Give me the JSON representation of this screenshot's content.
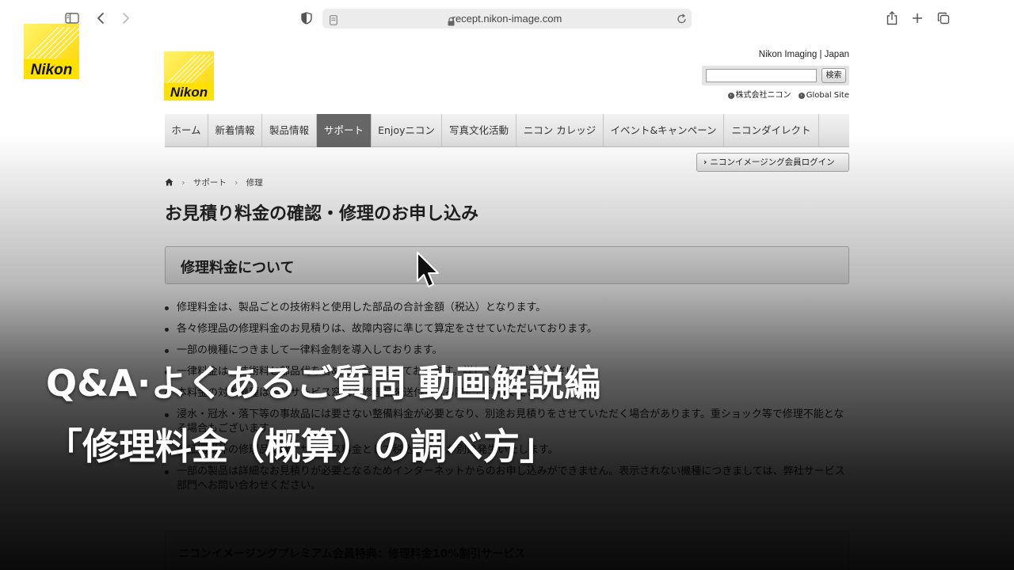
{
  "browser": {
    "url": "recept.nikon-image.com",
    "icons": [
      "sidebar-icon",
      "back-icon",
      "forward-icon",
      "shield-icon",
      "page-icon",
      "lock-icon",
      "reload-icon",
      "share-icon",
      "new-tab-icon",
      "tabs-icon"
    ]
  },
  "brand": {
    "logo_text": "Nikon",
    "accent": "#ffe100"
  },
  "header": {
    "site_label": "Nikon Imaging | Japan",
    "search_button": "検索",
    "search_value": "",
    "corp_link": "株式会社ニコン",
    "global_link": "Global Site"
  },
  "nav": {
    "items": [
      {
        "label": "ホーム",
        "active": false
      },
      {
        "label": "新着情報",
        "active": false
      },
      {
        "label": "製品情報",
        "active": false
      },
      {
        "label": "サポート",
        "active": true
      },
      {
        "label": "Enjoyニコン",
        "active": false
      },
      {
        "label": "写真文化活動",
        "active": false
      },
      {
        "label": "ニコン カレッジ",
        "active": false
      },
      {
        "label": "イベント&キャンペーン",
        "active": false
      },
      {
        "label": "ニコンダイレクト",
        "active": false
      }
    ],
    "login": "ニコンイメージング会員ログイン"
  },
  "breadcrumb": {
    "items": [
      "サポート",
      "修理"
    ]
  },
  "page": {
    "title": "お見積り料金の確認・修理のお申し込み",
    "section_title": "修理料金について",
    "notes": [
      "修理料金は、製品ごとの技術料と使用した部品の合計金額（税込）となります。",
      "各々修理品の修理料金のお見積りは、故障内容に準じて算定をさせていただいております。",
      "一部の機種につきまして一律料金制を導入しております。",
      "一律料金は、技術料と部品代を含めた料金となっております。詳しくはご確認ください。",
      "本料金の対象機種は弊社サービス窓口へ修理品を送付される際にご利用ください。",
      "浸水・冠水・落下等の事故品には要さない整備料金が必要となり、別途お見積りをさせていただく場合があります。重ショック等で修理不能となる場合もございます。",
      "保証期間外の修理品には、サービス料金として税込¥1870が別途発生いたします。",
      "一部の製品は詳細なお見積りが必要となるためインターネットからのお申し込みができません。表示されない機種につきましては、弊社サービス部門へお問い合わせください。"
    ],
    "bottom_box": "ニコンイメージングプレミアム会員特典：修理料金10%割引サービス"
  },
  "overlay": {
    "caption_line1": "Q&A·よくあるご質問 動画解説編",
    "caption_line2": "「修理料金（概算）の調べ方」"
  }
}
